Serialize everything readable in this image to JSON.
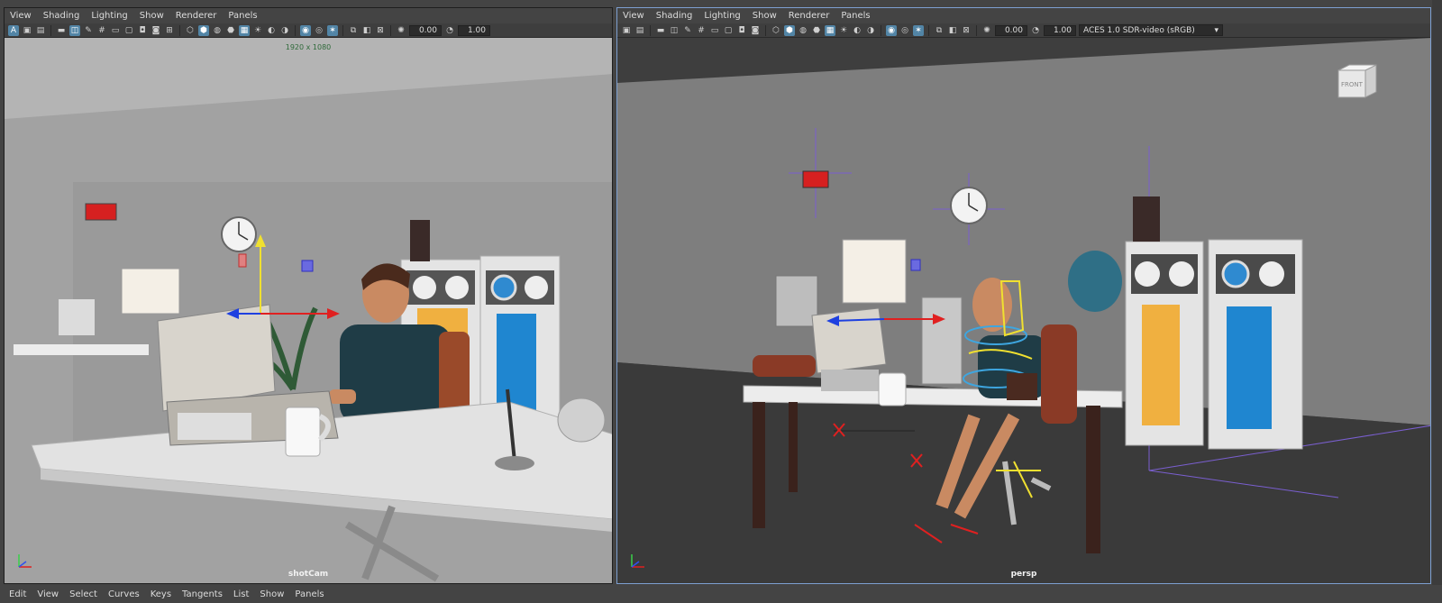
{
  "viewport_menu": [
    "View",
    "Shading",
    "Lighting",
    "Show",
    "Renderer",
    "Panels"
  ],
  "left_panel": {
    "exposure": "0.00",
    "gamma": "1.00",
    "resolution_label": "1920 x 1080",
    "camera_label": "shotCam"
  },
  "right_panel": {
    "exposure": "0.00",
    "gamma": "1.00",
    "color_transform": "ACES 1.0 SDR-video (sRGB)",
    "camera_label": "persp",
    "view_cube_label": "FRONT"
  },
  "bottom_menu": [
    "Edit",
    "View",
    "Select",
    "Curves",
    "Keys",
    "Tangents",
    "List",
    "Show",
    "Panels"
  ],
  "colors": {
    "accent": "#5285a6",
    "active_panel_border": "#7d9fd0",
    "axis_x": "#e02020",
    "axis_y": "#f0e030",
    "axis_z": "#1e40e0"
  }
}
